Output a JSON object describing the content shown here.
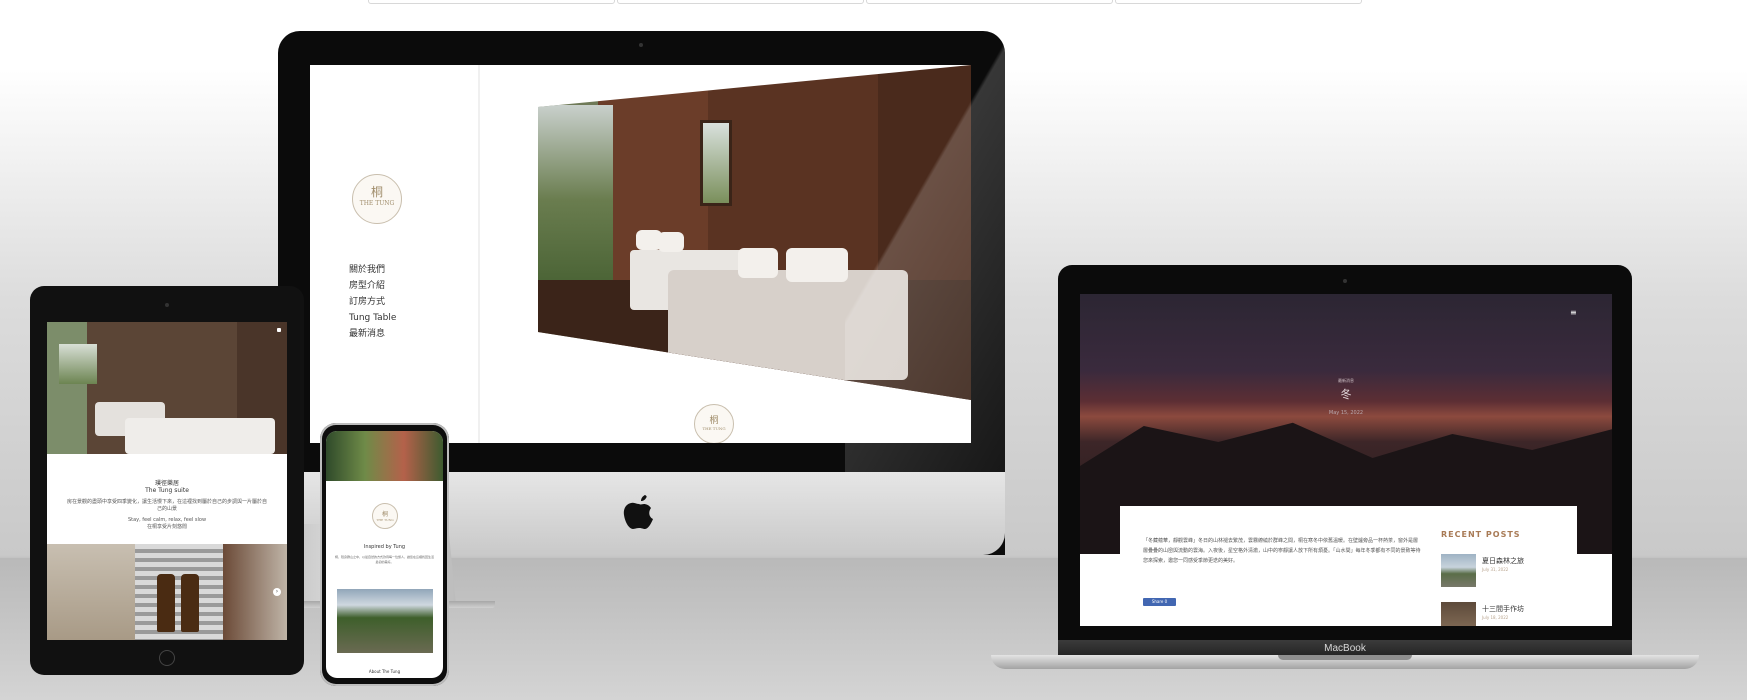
{
  "imac": {
    "logo_cn": "桐",
    "logo_en": "THE TUNG",
    "nav": [
      "關於我們",
      "房型介紹",
      "訂房方式",
      "Tung Table",
      "最新消息"
    ]
  },
  "ipad": {
    "title_cn": "璞徑樂居",
    "title_en": "The Tung suite",
    "desc1": "房在景觀的盡頭中享受四季變化，讓生活慢下來，在這裡找到屬於自己的步調與一片屬於自己的山景",
    "desc2": "Stay, feel calm, relax, feel slow",
    "desc3": "在桐享受片刻悠閒"
  },
  "iphone": {
    "heading": "Inspired by Tung",
    "desc": "桐，隱身群山之中，以最自然的方式款待每一位旅人，讓您在這裡找回生活最初的美好。",
    "footer": "About The Tung"
  },
  "macbook": {
    "menu_icon": "≡",
    "hero_category": "最新消息",
    "hero_title": "冬",
    "hero_date": "May 15, 2022",
    "article": "「冬藏蘊華，靜觀雲峰」冬日的山林褪去繁茂，雲霧繚繞於群峰之間，桐在寒冬中依舊溫暖。在壁爐旁品一杯熱茶，窗外是層層疊疊的山巒與流動的雲海。入夜後，星空格外清澈，山中的寧靜讓人放下所有煩憂。「山水間」每年冬季都有不同的景致等待您來探索，邀您一同感受季節更迭的美好。",
    "share_label": "Share 0",
    "recent_heading": "RECENT POSTS",
    "posts": [
      {
        "title": "夏日森林之旅",
        "date": "July 31, 2022"
      },
      {
        "title": "十三間手作坊",
        "date": "July 18, 2022"
      }
    ],
    "brand": "MacBook"
  }
}
